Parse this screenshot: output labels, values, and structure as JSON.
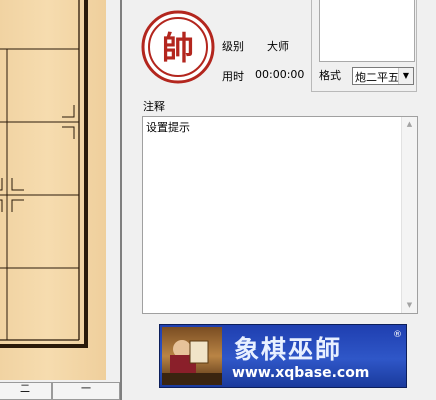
{
  "info": {
    "level_label": "级别",
    "level_value": "大师",
    "time_label": "用时",
    "time_value": "00:00:00"
  },
  "avatar": {
    "char": "帥",
    "color": "#b3261e"
  },
  "format": {
    "label": "格式",
    "selected": "炮二平五"
  },
  "notes": {
    "label": "注释",
    "text": "设置提示"
  },
  "banner": {
    "title": "象棋巫師",
    "registered_mark": "®",
    "url": "www.xqbase.com"
  },
  "status_cells": [
    "二",
    "一"
  ],
  "colors": {
    "board": "#f3d6a6",
    "brand_red": "#b3261e",
    "banner_blue": "#2a4fc0"
  }
}
